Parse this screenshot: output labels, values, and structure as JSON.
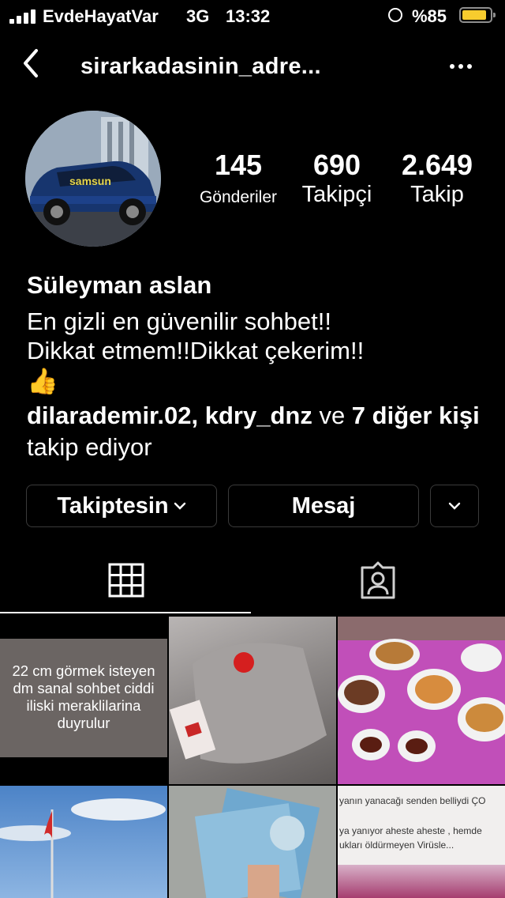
{
  "status_bar": {
    "carrier": "EvdeHayatVar",
    "network": "3G",
    "time": "13:32",
    "battery_percent": "%85"
  },
  "nav": {
    "username": "sirarkadasinin_adre...",
    "back_icon": "chevron-left-icon",
    "more_icon": "ellipsis-icon"
  },
  "profile": {
    "avatar_text": "samsun",
    "posts": {
      "count": "145",
      "label": "Gönderiler"
    },
    "followers": {
      "count": "690",
      "label": "Takipçi"
    },
    "following": {
      "count": "2.649",
      "label": "Takip"
    },
    "name": "Süleyman aslan",
    "bio_line1": "En gizli en güvenilir sohbet!!",
    "bio_line2": "Dikkat etmem!!Dikkat çekerim!!",
    "bio_emoji": "👍",
    "followed_by_users": "dilarademir.02, kdry_dnz",
    "followed_by_and": " ve ",
    "followed_by_others": "7 diğer kişi",
    "followed_by_suffix": " takip ediyor"
  },
  "actions": {
    "following_label": "Takiptesin",
    "message_label": "Mesaj"
  },
  "tabs": {
    "grid_icon": "grid-icon",
    "tagged_icon": "tagged-person-icon",
    "active": "grid"
  },
  "posts": {
    "post1_text": "22 cm görmek isteyen dm sanal sohbet ciddi iliski meraklilarina duyrulur",
    "post6_line1": "yanın yanacağı senden belliydi ÇO",
    "post6_line2": "ya yanıyor aheste aheste , hemde",
    "post6_line3": "ukları öldürmeyen Virüsle..."
  },
  "colors": {
    "background": "#000000",
    "button_border": "#3a3a3a",
    "battery_fill": "#f7cc2e"
  }
}
